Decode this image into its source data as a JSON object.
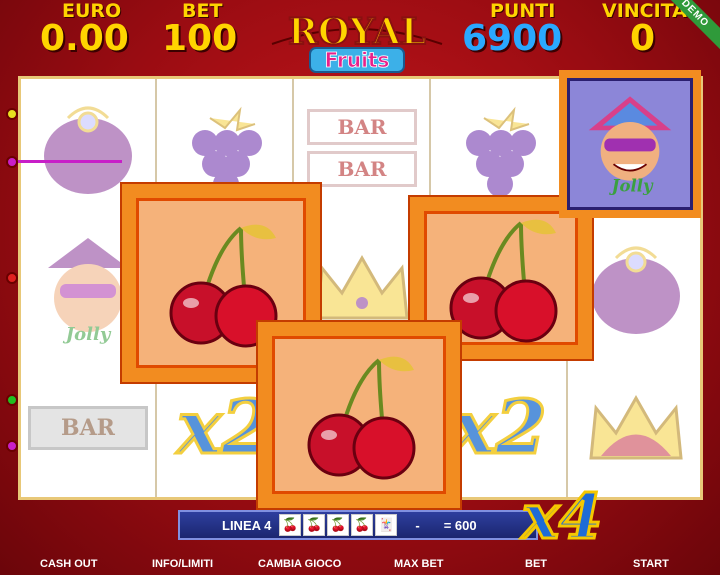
{
  "hud": {
    "euro_label": "EURO",
    "euro_value": "0.00",
    "bet_label": "BET",
    "bet_value": "100",
    "punti_label": "PUNTI",
    "punti_value": "6900",
    "vincita_label": "VINCITA",
    "vincita_value": "0"
  },
  "logo": {
    "line1": "ROYAL",
    "line2": "Fruits"
  },
  "badge": "DEMO",
  "reels": {
    "bar_label": "BAR",
    "x2_label": "x2",
    "jolly_label": "Jolly"
  },
  "win": {
    "line_label": "LINEA 4",
    "separator": "-",
    "amount": "= 600",
    "multiplier": "x4",
    "symbol_count": 5
  },
  "buttons": {
    "cash_out": "CASH OUT",
    "info": "INFO/LIMITI",
    "change_game": "CAMBIA GIOCO",
    "max_bet": "MAX BET",
    "bet": "BET",
    "start": "START"
  },
  "colors": {
    "hud_label": "#ffd400",
    "euro": "#ffd400",
    "punti": "#2aa8ff",
    "background": "#b3121a",
    "win_frame": "#f28c20",
    "payline": "#c81ec8"
  }
}
